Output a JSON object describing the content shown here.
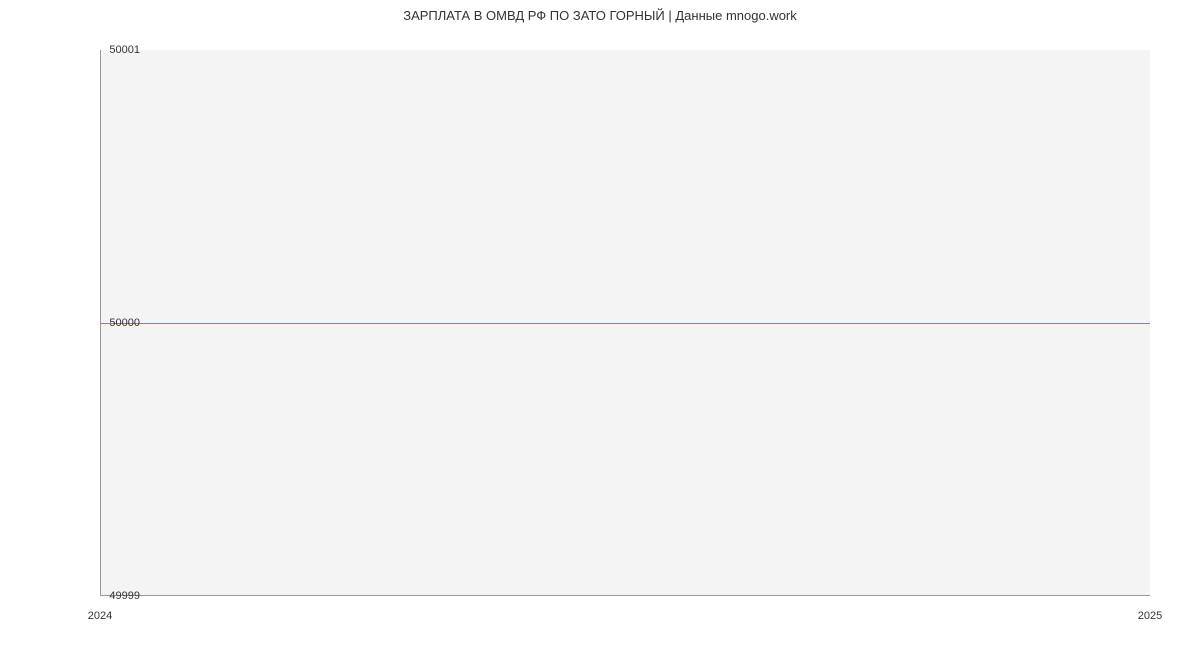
{
  "chart_data": {
    "type": "line",
    "title": "ЗАРПЛАТА В ОМВД РФ ПО ЗАТО ГОРНЫЙ | Данные mnogo.work",
    "x": [
      2024,
      2025
    ],
    "y": [
      50000,
      50000
    ],
    "xlabel": "",
    "ylabel": "",
    "x_ticks": [
      "2024",
      "2025"
    ],
    "y_ticks": [
      "49999",
      "50000",
      "50001"
    ],
    "xlim": [
      2024,
      2025
    ],
    "ylim": [
      49999,
      50001
    ]
  }
}
